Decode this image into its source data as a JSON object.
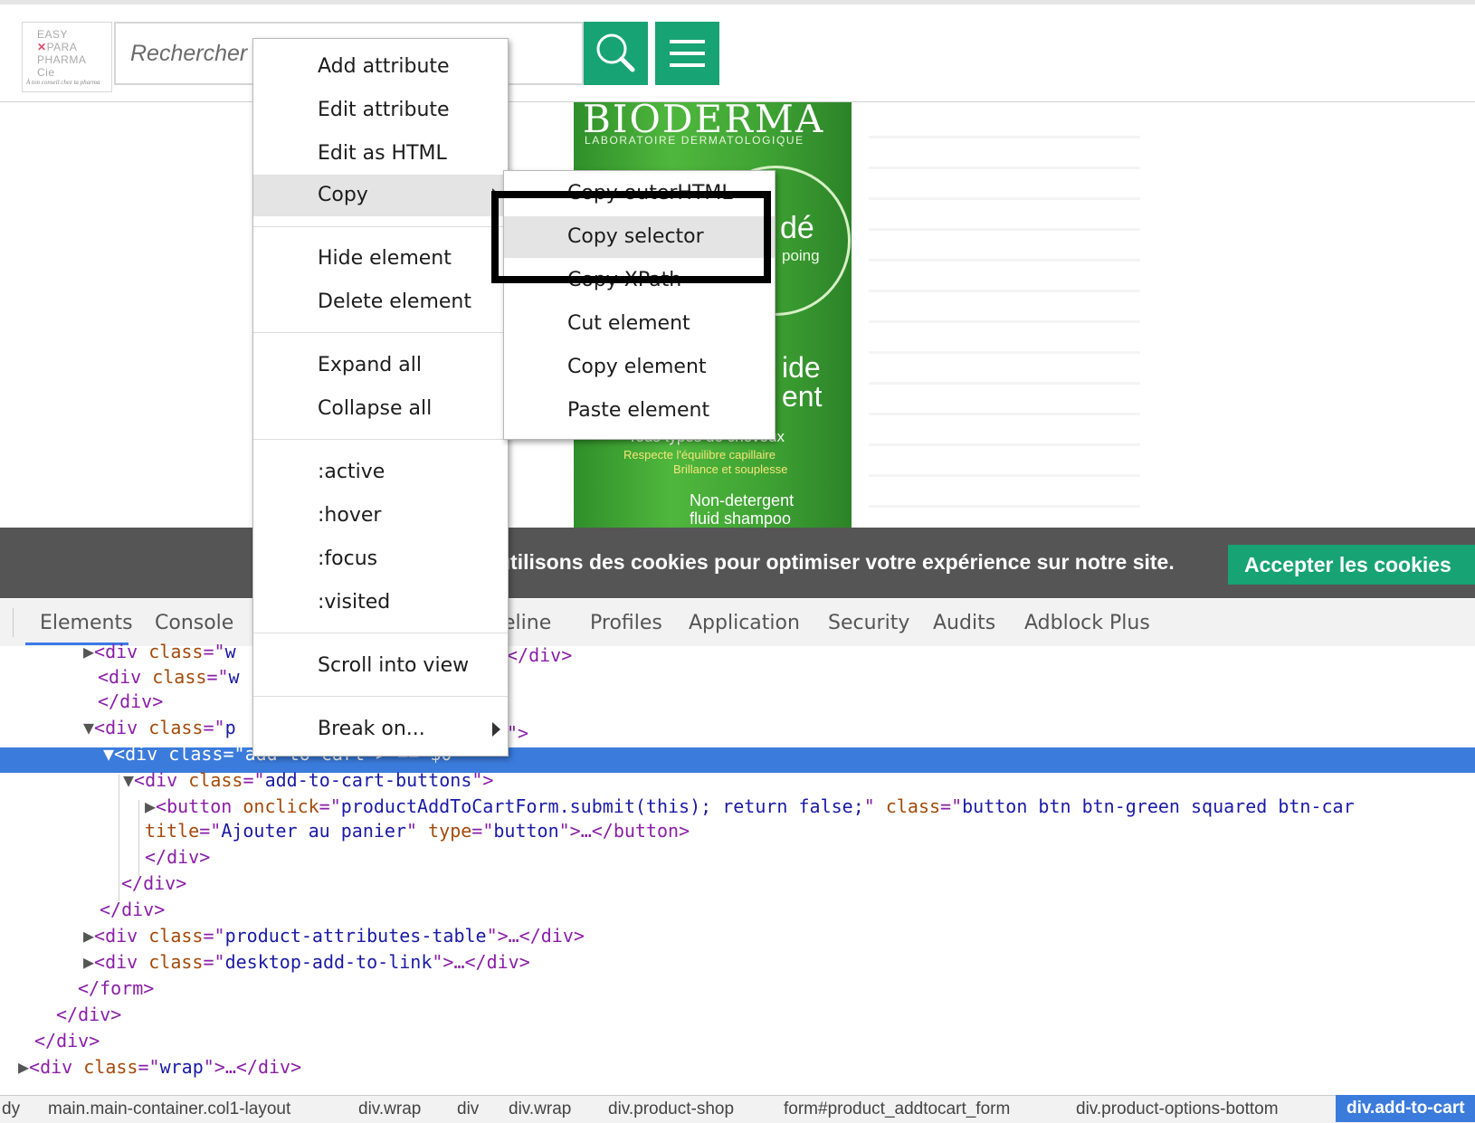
{
  "header": {
    "logo_lines": [
      "EASY",
      "PARA",
      "PHARMA",
      "Cie"
    ],
    "logo_tagline": "À ton conseil chez ta pharma",
    "search_placeholder": "Rechercher un produit, une marque...",
    "search_icon": "search-icon",
    "menu_icon": "hamburger-icon",
    "accent_color": "#17a374"
  },
  "product": {
    "brand": "BIODERMA",
    "brand_sub": "LABORATOIRE DERMATOLOGIQUE",
    "name_a": "dé",
    "name_b": "poing",
    "name_c": "ide",
    "name_d": "ent",
    "line1": "Tous types de cheveux",
    "line2": "Respecte l'équilibre capillaire",
    "line3": "Brillance et souplesse",
    "line4": "Non-detergent",
    "line5": "fluid shampoo"
  },
  "cookie": {
    "text": "utilisons des cookies pour optimiser votre expérience sur notre site.",
    "button": "Accepter les cookies"
  },
  "devtools": {
    "tabs": [
      "Elements",
      "Console",
      "eline",
      "Profiles",
      "Application",
      "Security",
      "Audits",
      "Adblock Plus"
    ],
    "dom_lines": [
      {
        "tri": "▶",
        "parts": [
          [
            "t",
            "<div "
          ],
          [
            "n",
            "class"
          ],
          [
            "t",
            "=\""
          ],
          [
            "v",
            "w"
          ]
        ]
      },
      {
        "tri": "",
        "parts": [
          [
            "t",
            "<div "
          ],
          [
            "n",
            "class"
          ],
          [
            "t",
            "=\""
          ],
          [
            "v",
            "w"
          ]
        ]
      },
      {
        "tri": "",
        "parts": [
          [
            "t",
            "</div>"
          ]
        ]
      },
      {
        "tri": "▼",
        "parts": [
          [
            "t",
            "<div "
          ],
          [
            "n",
            "class"
          ],
          [
            "t",
            "=\""
          ],
          [
            "v",
            "p"
          ]
        ]
      },
      {
        "tri": "▼",
        "parts": [
          [
            "t",
            "<div "
          ],
          [
            "n",
            "class"
          ],
          [
            "t",
            "=\""
          ],
          [
            "v",
            "add-to-cart"
          ],
          [
            "t",
            "\"> == $0"
          ]
        ]
      },
      {
        "tri": "▼",
        "parts": [
          [
            "t",
            "<div "
          ],
          [
            "n",
            "class"
          ],
          [
            "t",
            "=\""
          ],
          [
            "v",
            "add-to-cart-buttons"
          ],
          [
            "t",
            "\">"
          ]
        ]
      },
      {
        "tri": "▶",
        "parts": [
          [
            "t",
            "<button "
          ],
          [
            "n",
            "onclick"
          ],
          [
            "t",
            "=\""
          ],
          [
            "v",
            "productAddToCartForm.submit(this); return false;"
          ],
          [
            "t",
            "\" "
          ],
          [
            "n",
            "class"
          ],
          [
            "t",
            "=\""
          ],
          [
            "v",
            "button btn btn-green squared btn-car"
          ]
        ]
      },
      {
        "tri": "",
        "parts": [
          [
            "n",
            "title"
          ],
          [
            "t",
            "=\""
          ],
          [
            "v",
            "Ajouter au panier"
          ],
          [
            "t",
            "\" "
          ],
          [
            "n",
            "type"
          ],
          [
            "t",
            "=\""
          ],
          [
            "v",
            "button"
          ],
          [
            "t",
            "\">…</button>"
          ]
        ]
      },
      {
        "tri": "",
        "parts": [
          [
            "t",
            "</div>"
          ]
        ]
      },
      {
        "tri": "",
        "parts": [
          [
            "t",
            "</div>"
          ]
        ]
      },
      {
        "tri": "",
        "parts": [
          [
            "t",
            "</div>"
          ]
        ]
      },
      {
        "tri": "▶",
        "parts": [
          [
            "t",
            "<div "
          ],
          [
            "n",
            "class"
          ],
          [
            "t",
            "=\""
          ],
          [
            "v",
            "product-attributes-table"
          ],
          [
            "t",
            "\">…</div>"
          ]
        ]
      },
      {
        "tri": "▶",
        "parts": [
          [
            "t",
            "<div "
          ],
          [
            "n",
            "class"
          ],
          [
            "t",
            "=\""
          ],
          [
            "v",
            "desktop-add-to-link"
          ],
          [
            "t",
            "\">…</div>"
          ]
        ]
      },
      {
        "tri": "",
        "parts": [
          [
            "t",
            "</form>"
          ]
        ]
      },
      {
        "tri": "",
        "parts": [
          [
            "t",
            "</div>"
          ]
        ]
      },
      {
        "tri": "",
        "parts": [
          [
            "t",
            "</div>"
          ]
        ]
      },
      {
        "tri": "▶",
        "parts": [
          [
            "t",
            "<div "
          ],
          [
            "n",
            "class"
          ],
          [
            "t",
            "=\""
          ],
          [
            "v",
            "wrap"
          ],
          [
            "t",
            "\">…</div>"
          ]
        ]
      }
    ],
    "right_tail_1": "</div>",
    "right_tail_2": "\">",
    "breadcrumbs": [
      "dy",
      "main.main-container.col1-layout",
      "div.wrap",
      "div",
      "div.wrap",
      "div.product-shop",
      "form#product_addtocart_form",
      "div.product-options-bottom"
    ],
    "breadcrumb_active": "div.add-to-cart"
  },
  "context_menu": {
    "items": [
      "Add attribute",
      "Edit attribute",
      "Edit as HTML",
      "Copy",
      "Hide element",
      "Delete element",
      "Expand all",
      "Collapse all",
      ":active",
      ":hover",
      ":focus",
      ":visited",
      "Scroll into view",
      "Break on..."
    ],
    "highlighted": "Copy"
  },
  "copy_submenu": {
    "items": [
      "Copy outerHTML",
      "Copy selector",
      "Copy XPath",
      "Cut element",
      "Copy element",
      "Paste element"
    ],
    "highlighted": "Copy selector"
  }
}
